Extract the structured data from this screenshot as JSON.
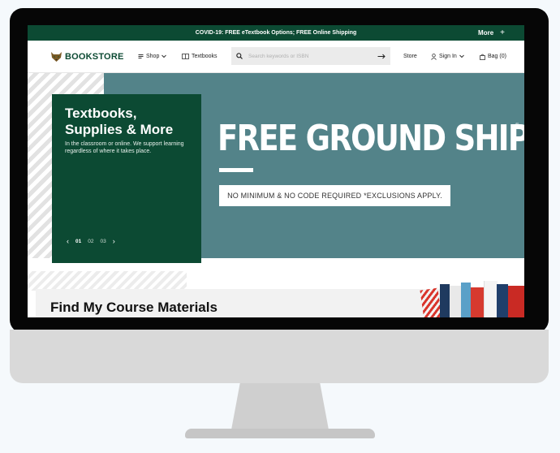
{
  "promo": {
    "message": "COVID-19: FREE eTextbook Options; FREE Online Shipping",
    "more_label": "More",
    "more_icon": "+"
  },
  "nav": {
    "logo_text": "BOOKSTORE",
    "shop_label": "Shop",
    "textbooks_label": "Textbooks",
    "search_placeholder": "Search keywords or ISBN",
    "store_label": "Store",
    "sign_in_label": "Sign In",
    "bag_label": "Bag (0)"
  },
  "hero": {
    "card_title": "Textbooks, Supplies & More",
    "card_subtitle": "In the classroom or online. We support learning regardless of where it takes place.",
    "slides": [
      "01",
      "02",
      "03"
    ],
    "active_slide": "01",
    "headline": "FREE GROUND SHIPPING",
    "registered_mark": "®",
    "subline": "NO MINIMUM & NO CODE REQUIRED *EXCLUSIONS APPLY."
  },
  "course": {
    "title": "Find My Course Materials"
  },
  "colors": {
    "brand_green": "#0c4a33",
    "hero_teal": "#538389",
    "bezel": "#060606"
  }
}
